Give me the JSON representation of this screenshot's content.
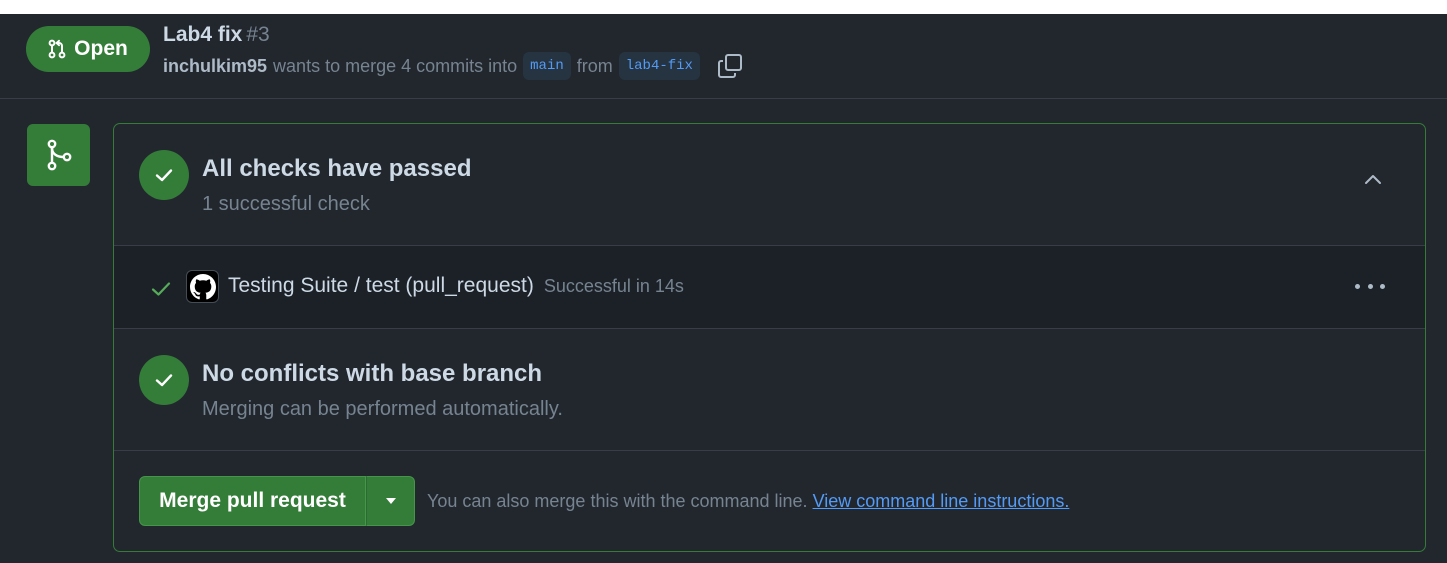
{
  "header": {
    "state_label": "Open",
    "title": "Lab4 fix",
    "number": "#3",
    "author": "inchulkim95",
    "merge_text": "wants to merge 4 commits into",
    "base_branch": "main",
    "from_text": "from",
    "head_branch": "lab4-fix"
  },
  "checks": {
    "title": "All checks have passed",
    "subtitle": "1 successful check",
    "items": [
      {
        "name": "Testing Suite / test (pull_request)",
        "status": "Successful in 14s"
      }
    ]
  },
  "conflicts": {
    "title": "No conflicts with base branch",
    "subtitle": "Merging can be performed automatically."
  },
  "merge": {
    "button_label": "Merge pull request",
    "hint_text": "You can also merge this with the command line.",
    "hint_link": "View command line instructions."
  },
  "colors": {
    "background": "#22272e",
    "success_green": "#347d39",
    "link_blue": "#539bf5",
    "muted_text": "#768390"
  },
  "icons": {
    "state": "git-pull-request-icon",
    "copy": "copy-icon",
    "merge_tile": "git-merge-icon",
    "check": "check-icon",
    "avatar": "github-logo-icon",
    "collapse": "chevron-up-icon",
    "more": "kebab-horizontal-icon",
    "dropdown": "triangle-down-icon"
  }
}
